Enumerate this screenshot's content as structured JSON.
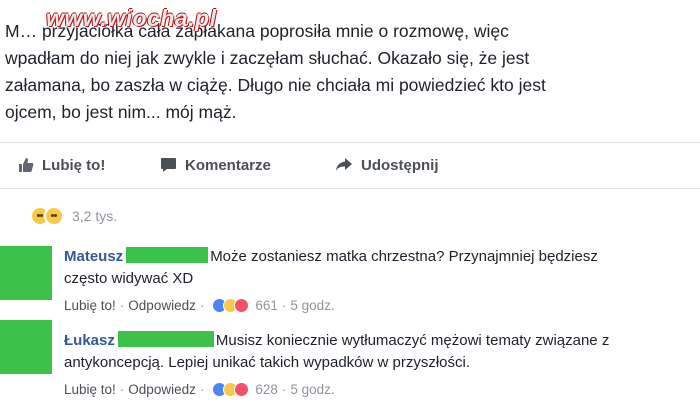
{
  "watermark": "www.wiocha.pl",
  "post": {
    "lines": [
      "M… przyjaciółka cała zapłakana poprosiła mnie o rozmowę, więc",
      "wpadłam do niej jak zwykle i zaczęłam słuchać. Okazało się, że jest",
      "załamana, bo zaszła w ciążę. Długo nie chciała mi powiedzieć kto jest",
      "ojcem, bo jest nim... mój mąż."
    ]
  },
  "actions": {
    "like": "Lubię to!",
    "comment": "Komentarze",
    "share": "Udostępnij"
  },
  "reactions": {
    "count": "3,2 tys."
  },
  "comments": [
    {
      "author": "Mateusz",
      "text_line1": "Może zostaniesz matka chrzestna? Przynajmniej będziesz",
      "text_line2": "często widywać XD",
      "like": "Lubię to!",
      "reply": "Odpowiedz",
      "reactions": "661",
      "time": "5 godz."
    },
    {
      "author": "Łukasz",
      "text_line1": "Musisz koniecznie wytłumaczyć mężowi tematy związane z",
      "text_line2": "antykoncepcją. Lepiej unikać takich wypadków w przyszłości.",
      "like": "Lubię to!",
      "reply": "Odpowiedz",
      "reactions": "628",
      "time": "5 godz."
    }
  ],
  "colors": {
    "author": "#365899",
    "avatar_block": "#3cc14a",
    "meta": "#90949c",
    "text": "#1d2129"
  }
}
